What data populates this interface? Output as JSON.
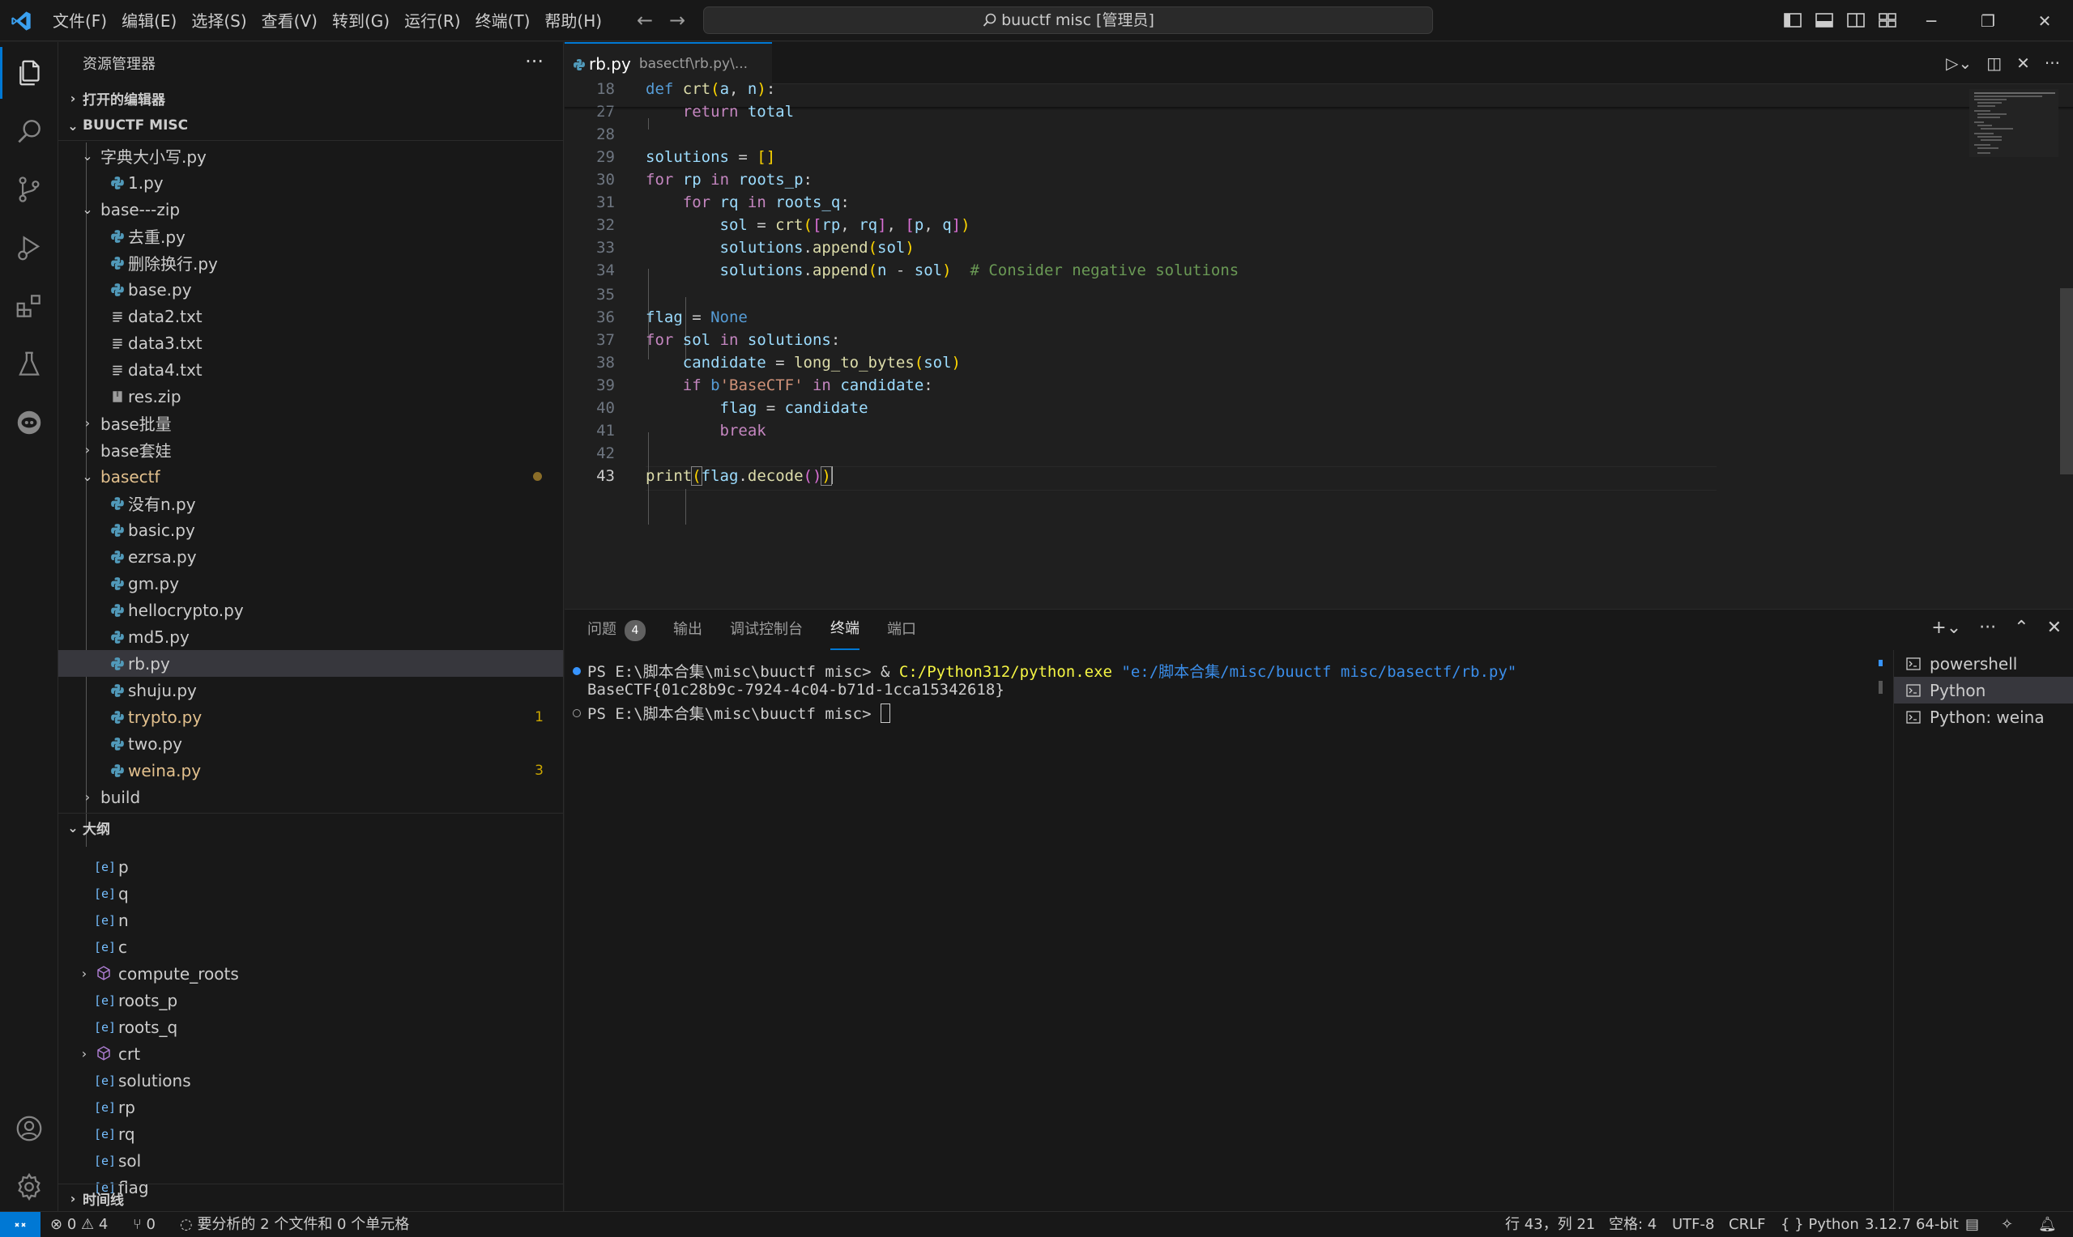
{
  "menu": [
    "文件(F)",
    "编辑(E)",
    "选择(S)",
    "查看(V)",
    "转到(G)",
    "运行(R)",
    "终端(T)",
    "帮助(H)"
  ],
  "command_center": "buuctf misc [管理员]",
  "sidebar": {
    "title": "资源管理器",
    "open_editors": "打开的编辑器",
    "workspace": "BUUCTF MISC",
    "tree": [
      {
        "label": "字典大小写.py",
        "type": "folder"
      },
      {
        "label": "1.py",
        "type": "py"
      },
      {
        "label": "base---zip",
        "type": "folder"
      },
      {
        "label": "去重.py",
        "type": "py"
      },
      {
        "label": "删除换行.py",
        "type": "py"
      },
      {
        "label": "base.py",
        "type": "py"
      },
      {
        "label": "data2.txt",
        "type": "txt"
      },
      {
        "label": "data3.txt",
        "type": "txt"
      },
      {
        "label": "data4.txt",
        "type": "txt"
      },
      {
        "label": "res.zip",
        "type": "zip"
      },
      {
        "label": "base批量",
        "type": "folder"
      },
      {
        "label": "base套娃",
        "type": "folder"
      },
      {
        "label": "basectf",
        "type": "folder"
      },
      {
        "label": "没有n.py",
        "type": "py"
      },
      {
        "label": "basic.py",
        "type": "py"
      },
      {
        "label": "ezrsa.py",
        "type": "py"
      },
      {
        "label": "gm.py",
        "type": "py"
      },
      {
        "label": "hellocrypto.py",
        "type": "py"
      },
      {
        "label": "md5.py",
        "type": "py"
      },
      {
        "label": "rb.py",
        "type": "py"
      },
      {
        "label": "shuju.py",
        "type": "py"
      },
      {
        "label": "trypto.py",
        "type": "py",
        "badge": "1"
      },
      {
        "label": "two.py",
        "type": "py"
      },
      {
        "label": "weina.py",
        "type": "py",
        "badge": "3"
      },
      {
        "label": "build",
        "type": "folder"
      }
    ],
    "outline_title": "大纲",
    "outline": [
      "p",
      "q",
      "n",
      "c",
      "compute_roots",
      "roots_p",
      "roots_q",
      "crt",
      "solutions",
      "rp",
      "rq",
      "sol",
      "flag"
    ],
    "timeline": "时间线"
  },
  "editor": {
    "tab_label": "rb.py",
    "tab_desc": "basectf\\rb.py\\...",
    "line_numbers": [
      "18",
      "27",
      "28",
      "29",
      "30",
      "31",
      "32",
      "33",
      "34",
      "35",
      "36",
      "37",
      "38",
      "39",
      "40",
      "41",
      "42",
      "43"
    ]
  },
  "panel": {
    "tabs": [
      "问题",
      "输出",
      "调试控制台",
      "终端",
      "端口"
    ],
    "problem_count": "4",
    "terminal_lines": [
      {
        "prompt": "PS E:\\脚本合集\\misc\\buuctf misc> ",
        "op": "& ",
        "exe": "C:/Python312/python.exe",
        "arg": " \"e:/脚本合集/misc/buuctf misc/basectf/rb.py\""
      },
      {
        "text": "BaseCTF{01c28b9c-7924-4c04-b71d-1cca15342618}"
      },
      {
        "prompt": "PS E:\\脚本合集\\misc\\buuctf misc> "
      }
    ],
    "terminals": [
      "powershell",
      "Python",
      "Python: weina"
    ]
  },
  "statusbar": {
    "errors": "0",
    "warnings": "4",
    "ports": "0",
    "analysis": "要分析的 2 个文件和 0 个单元格",
    "position": "行 43，列 21",
    "spaces": "空格: 4",
    "encoding": "UTF-8",
    "eol": "CRLF",
    "language": "Python",
    "interpreter": "3.12.7 64-bit"
  },
  "colors": {
    "accent": "#0078d4",
    "background": "#1f1f1f",
    "modified": "#e2c08d"
  }
}
